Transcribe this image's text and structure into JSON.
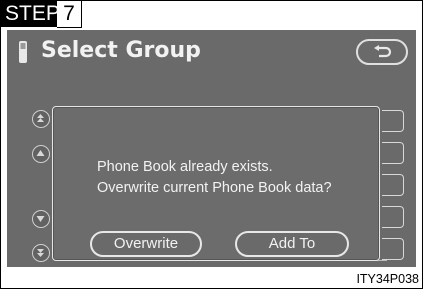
{
  "step": {
    "label": "STEP",
    "number": "7"
  },
  "header": {
    "title": "Select Group",
    "phone_icon": "phone-icon",
    "back_icon": "u-turn-arrow-icon"
  },
  "side_arrows": [
    "double-up-arrow-icon",
    "up-arrow-icon",
    "down-arrow-icon",
    "double-down-arrow-icon"
  ],
  "dialog": {
    "message_line1": "Phone Book already exists.",
    "message_line2": "Overwrite current Phone Book data?",
    "overwrite_label": "Overwrite",
    "add_to_label": "Add To"
  },
  "figure_code": "ITY34P038",
  "colors": {
    "screen": "#6a6a6a",
    "text": "#f2f2f2",
    "outline": "#e0e0e0"
  }
}
